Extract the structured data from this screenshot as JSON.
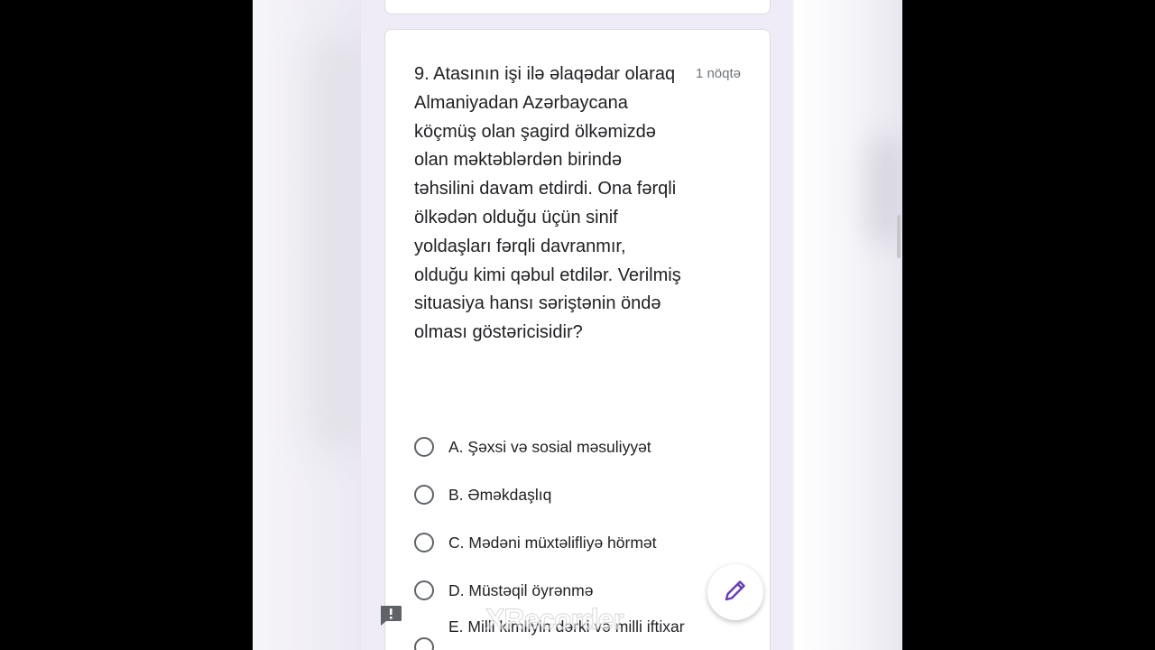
{
  "question": {
    "text": "9. Atasının işi ilə əlaqədar olaraq Almaniyadan Azərbaycana köçmüş olan şagird ölkəmizdə olan məktəblərdən birində təhsilini davam etdirdi. Ona fərqli ölkədən olduğu üçün sinif yoldaşları fərqli davranmır, olduğu kimi qəbul etdilər. Verilmiş situasiya hansı səriştənin öndə olması göstəricisidir?",
    "points": "1 nöqtə"
  },
  "options": [
    {
      "label": "A. Şəxsi və sosial məsuliyyət"
    },
    {
      "label": "B. Əməkdaşlıq"
    },
    {
      "label": "C. Mədəni müxtəlifliyə hörmət"
    },
    {
      "label": "D. Müstəqil öyrənmə"
    },
    {
      "label": "E. Milli kimliyin dərki və milli iftixar"
    }
  ],
  "icons": {
    "fab": "pencil-icon",
    "report": "report-problem-icon"
  },
  "watermark": "XRecorder",
  "colors": {
    "accent": "#673ab7",
    "form_background": "#efebf7",
    "card": "#ffffff",
    "text": "#202124",
    "muted": "#70757a"
  }
}
